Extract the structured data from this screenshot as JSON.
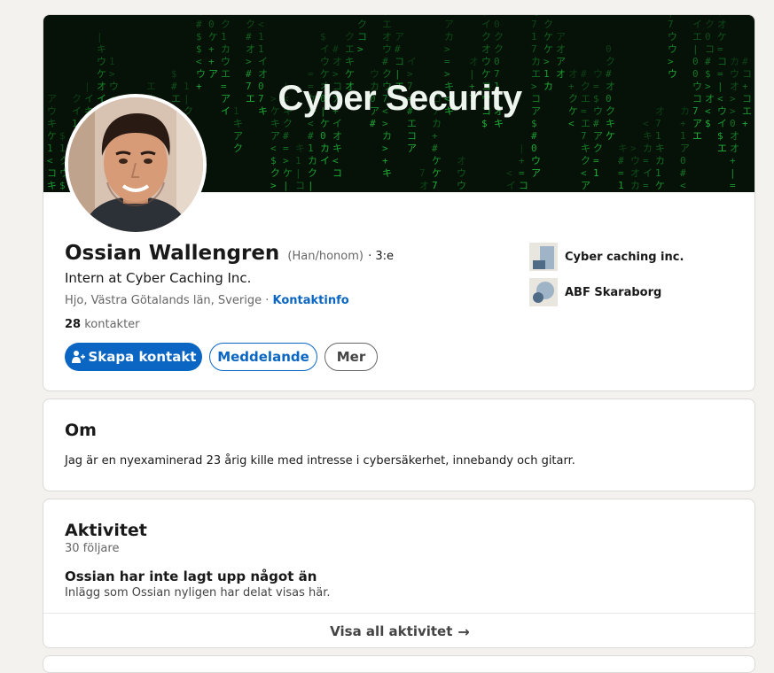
{
  "banner": {
    "title": "Cyber Security"
  },
  "profile": {
    "name": "Ossian Wallengren",
    "pronouns": "(Han/honom)",
    "degree": "· 3:e",
    "headline": "Intern at Cyber Caching Inc.",
    "location": "Hjo, Västra Götalands län, Sverige ·",
    "contact_info_label": "Kontaktinfo",
    "connections_count": "28",
    "connections_label": "kontakter"
  },
  "actions": {
    "connect_label": "Skapa kontakt",
    "message_label": "Meddelande",
    "more_label": "Mer"
  },
  "companies": [
    {
      "name": "Cyber caching inc.",
      "logo_icon": "company-logo-icon"
    },
    {
      "name": "ABF Skaraborg",
      "logo_icon": "school-logo-icon"
    }
  ],
  "about": {
    "title": "Om",
    "text": "Jag är en nyexaminerad 23 årig kille med intresse i cybersäkerhet, innebandy och gitarr."
  },
  "activity": {
    "title": "Aktivitet",
    "followers": "30 följare",
    "empty_title": "Ossian har inte lagt upp något än",
    "empty_text": "Inlägg som Ossian nyligen har delat visas här.",
    "show_all_label": "Visa all aktivitet",
    "arrow_icon": "→"
  },
  "colors": {
    "brand_blue": "#0a66c2",
    "page_bg": "#f4f2ee",
    "matrix_green": "#1fbf3a"
  }
}
